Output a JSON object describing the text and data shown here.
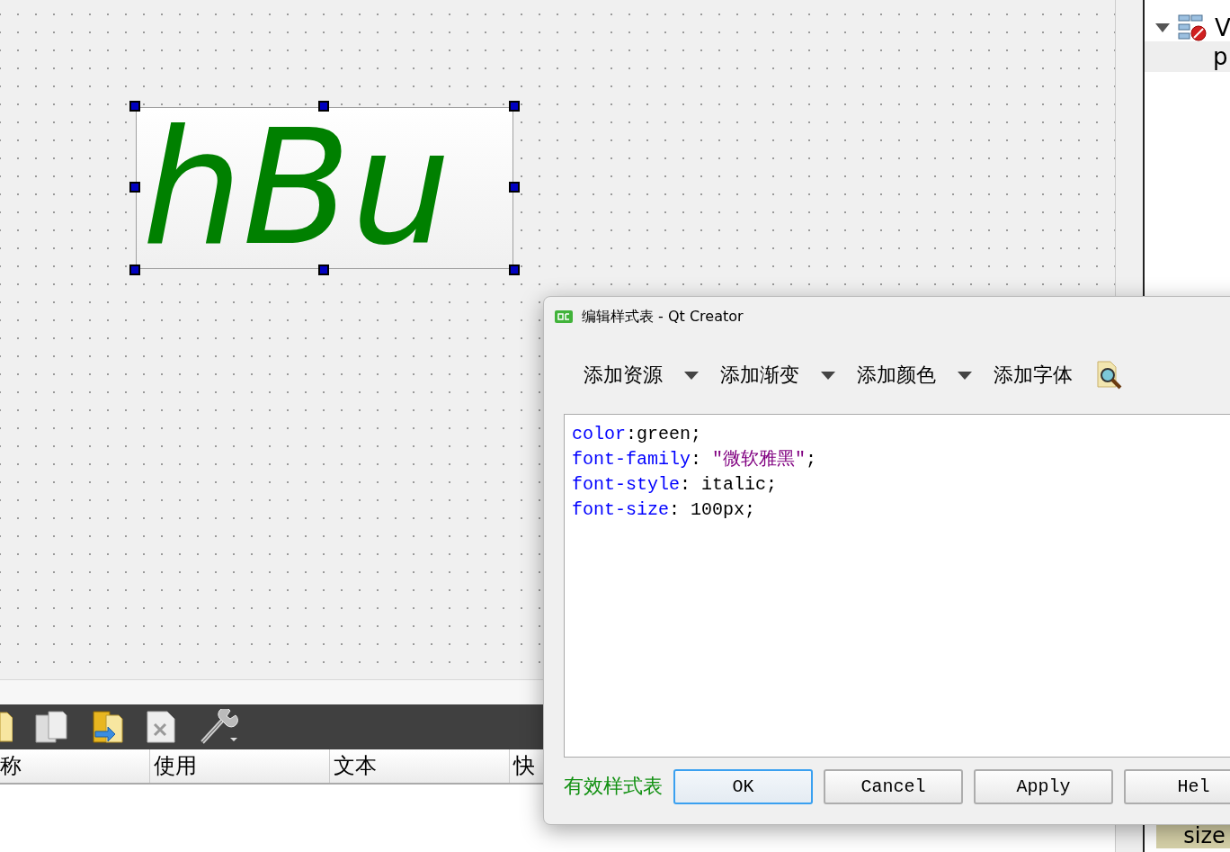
{
  "form_canvas": {
    "push_button": {
      "text": "hBu"
    }
  },
  "object_tree": {
    "items": [
      {
        "label": "V",
        "expanded": true,
        "children": [
          {
            "label": "p",
            "selected": true
          }
        ]
      }
    ]
  },
  "action_editor": {
    "toolbar": [
      {
        "kind": "document"
      },
      {
        "kind": "pages"
      },
      {
        "kind": "document-arrow"
      },
      {
        "kind": "delete-file"
      },
      {
        "kind": "wrench"
      }
    ],
    "columns": [
      "称",
      "使用",
      "文本",
      "快"
    ]
  },
  "property_editor": {
    "row": "size"
  },
  "dialog": {
    "title": "编辑样式表 - Qt Creator",
    "toolbar": [
      {
        "label": "添加资源",
        "kind": "dropdown"
      },
      {
        "label": "添加渐变",
        "kind": "dropdown"
      },
      {
        "label": "添加颜色",
        "kind": "dropdown"
      },
      {
        "label": "添加字体",
        "kind": "button"
      }
    ],
    "code": [
      [
        {
          "text": "color",
          "kind": "property"
        },
        {
          "text": ":green;",
          "kind": "plain"
        }
      ],
      [
        {
          "text": "font-family",
          "kind": "property"
        },
        {
          "text": ": ",
          "kind": "plain"
        },
        {
          "text": "\"微软雅黑\"",
          "kind": "string"
        },
        {
          "text": ";",
          "kind": "plain"
        }
      ],
      [
        {
          "text": "font-style",
          "kind": "property"
        },
        {
          "text": ": italic;",
          "kind": "plain"
        }
      ],
      [
        {
          "text": "font-size",
          "kind": "property"
        },
        {
          "text": ": 100px;",
          "kind": "plain"
        }
      ]
    ],
    "status": "有效样式表",
    "buttons": [
      {
        "label": "OK",
        "focused": true
      },
      {
        "label": "Cancel",
        "focused": false
      },
      {
        "label": "Apply",
        "focused": false
      },
      {
        "label": "Hel",
        "focused": false
      }
    ]
  }
}
